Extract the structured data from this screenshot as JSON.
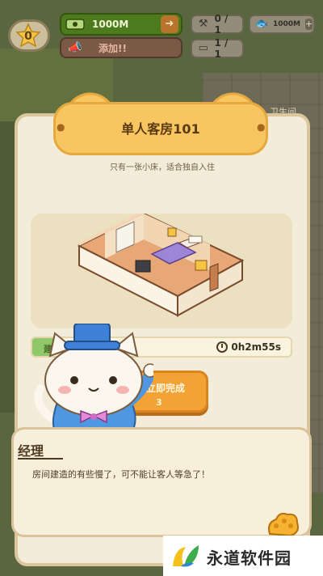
{
  "hud": {
    "level": "0",
    "money": "1000M",
    "invite_label": "添加!!",
    "staff_count": "0 / 1",
    "room_count": "1 / 1",
    "fish_currency": "1000M"
  },
  "scene": {
    "side_label": "卫生间"
  },
  "room": {
    "title": "单人客房101",
    "description": "只有一张小床，适合独自入住"
  },
  "construction": {
    "label": "建造中",
    "progress": 0.08,
    "time_remaining": "0h2m55s",
    "finish_label": "立即完成",
    "finish_cost": "3"
  },
  "dialogue": {
    "speaker": "经理",
    "message": "房间建造的有些慢了，可不能让客人等急了！"
  },
  "watermark": {
    "text": "永道软件园"
  },
  "colors": {
    "header": "#f8c660",
    "button": "#f3a334",
    "progress_fill": "#8fc76a",
    "money_bar": "#4e7a1e"
  }
}
